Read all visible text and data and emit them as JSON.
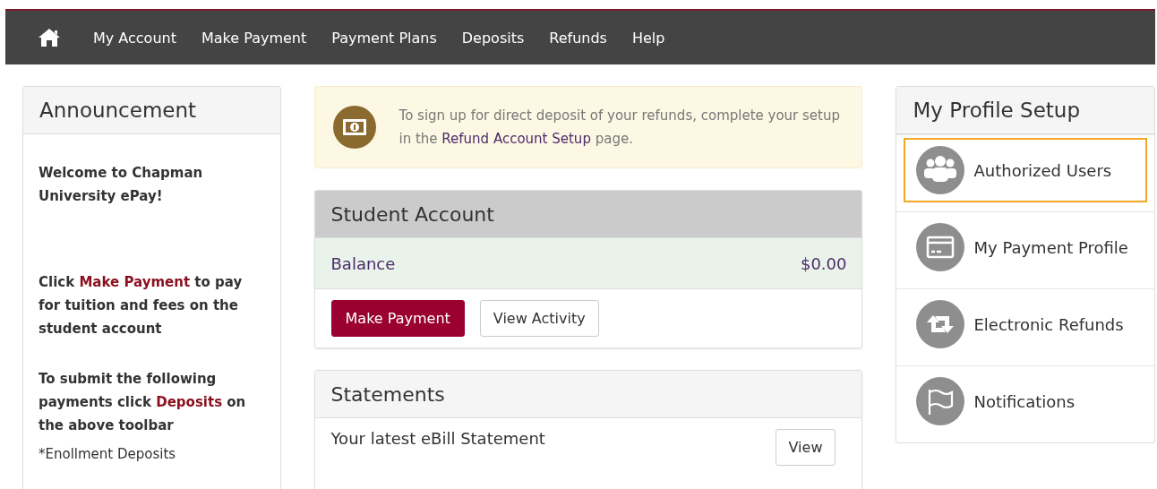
{
  "nav": {
    "items": [
      {
        "label": "My Account"
      },
      {
        "label": "Make Payment"
      },
      {
        "label": "Payment Plans"
      },
      {
        "label": "Deposits"
      },
      {
        "label": "Refunds"
      },
      {
        "label": "Help"
      }
    ]
  },
  "announcement": {
    "title": "Announcement",
    "paragraphs": [
      {
        "before": "Welcome to Chapman University ePay!"
      },
      {
        "before": "Click ",
        "link": "Make Payment",
        "after": " to pay for tuition and fees on the student account"
      },
      {
        "before": "To submit the following payments click ",
        "link": "Deposits",
        "after": " on the above toolbar"
      }
    ],
    "note": "*Enollment Deposits"
  },
  "alert": {
    "text_before": "To sign up for direct deposit of your refunds, complete your setup in the ",
    "link": "Refund Account Setup",
    "text_after": " page."
  },
  "student_account": {
    "title": "Student Account",
    "balance_label": "Balance",
    "balance_value": "$0.00",
    "buttons": [
      {
        "label": "Make Payment",
        "kind": "primary"
      },
      {
        "label": "View Activity",
        "kind": "default"
      }
    ]
  },
  "statements": {
    "title": "Statements",
    "text": "Your latest eBill Statement",
    "button": "View"
  },
  "profile": {
    "title": "My Profile Setup",
    "items": [
      {
        "label": "Authorized Users",
        "kind": "users",
        "selected": true
      },
      {
        "label": "My Payment Profile",
        "kind": "card",
        "selected": false
      },
      {
        "label": "Electronic Refunds",
        "kind": "refund",
        "selected": false
      },
      {
        "label": "Notifications",
        "kind": "flag",
        "selected": false
      }
    ]
  }
}
